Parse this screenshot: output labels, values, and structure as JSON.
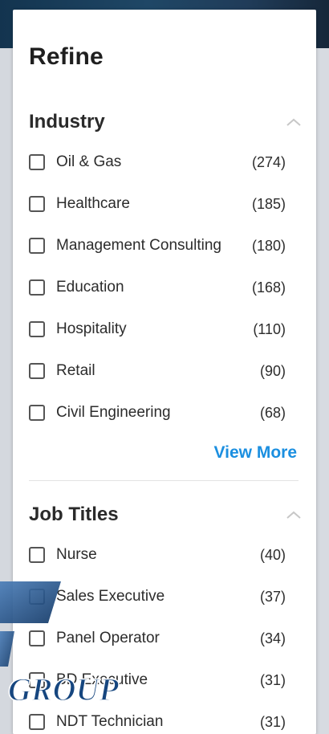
{
  "panel": {
    "title": "Refine"
  },
  "industry": {
    "title": "Industry",
    "chevron_icon": "chevron-up-icon",
    "items": [
      {
        "label": "Oil & Gas",
        "count": "(274)"
      },
      {
        "label": "Healthcare",
        "count": "(185)"
      },
      {
        "label": "Management Consulting",
        "count": "(180)"
      },
      {
        "label": "Education",
        "count": "(168)"
      },
      {
        "label": "Hospitality",
        "count": "(110)"
      },
      {
        "label": "Retail",
        "count": "(90)"
      },
      {
        "label": "Civil Engineering",
        "count": "(68)"
      }
    ],
    "view_more": "View More"
  },
  "job_titles": {
    "title": "Job Titles",
    "chevron_icon": "chevron-up-icon",
    "items": [
      {
        "label": "Nurse",
        "count": "(40)"
      },
      {
        "label": "Sales Executive",
        "count": "(37)"
      },
      {
        "label": "Panel Operator",
        "count": "(34)"
      },
      {
        "label": "BD Executive",
        "count": "(31)"
      },
      {
        "label": "NDT Technician",
        "count": "(31)"
      }
    ]
  },
  "watermark": {
    "text": "GROUP"
  },
  "colors": {
    "accent": "#1b8fe0",
    "text": "#2c2c2c",
    "header_bg": "#1f4766"
  }
}
